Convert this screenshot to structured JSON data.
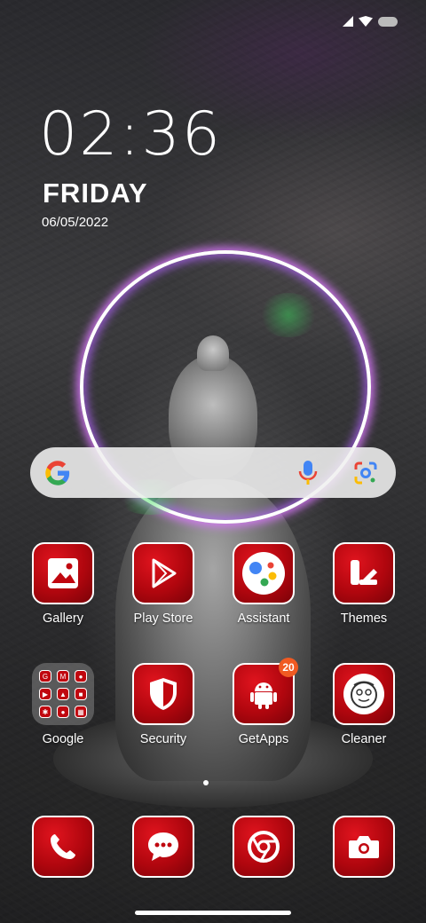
{
  "clock": {
    "time": "02:36",
    "day": "FRIDAY",
    "date": "06/05/2022"
  },
  "search": {
    "logo_icon": "google-g-icon",
    "mic_icon": "mic-icon",
    "lens_icon": "google-lens-icon"
  },
  "apps_row1": [
    {
      "label": "Gallery",
      "icon": "gallery-icon"
    },
    {
      "label": "Play Store",
      "icon": "play-store-icon"
    },
    {
      "label": "Assistant",
      "icon": "assistant-icon"
    },
    {
      "label": "Themes",
      "icon": "themes-icon"
    }
  ],
  "apps_row2": [
    {
      "label": "Google",
      "icon": "folder-icon"
    },
    {
      "label": "Security",
      "icon": "shield-icon"
    },
    {
      "label": "GetApps",
      "icon": "android-icon",
      "badge": "20"
    },
    {
      "label": "Cleaner",
      "icon": "cleaner-icon"
    }
  ],
  "dock": [
    {
      "name": "phone",
      "icon": "phone-icon"
    },
    {
      "name": "messages",
      "icon": "message-icon"
    },
    {
      "name": "chrome",
      "icon": "chrome-icon"
    },
    {
      "name": "camera",
      "icon": "camera-icon"
    }
  ],
  "colors": {
    "icon_red": "#c0070f",
    "badge": "#f05a22",
    "ring": "#dc78ff"
  }
}
